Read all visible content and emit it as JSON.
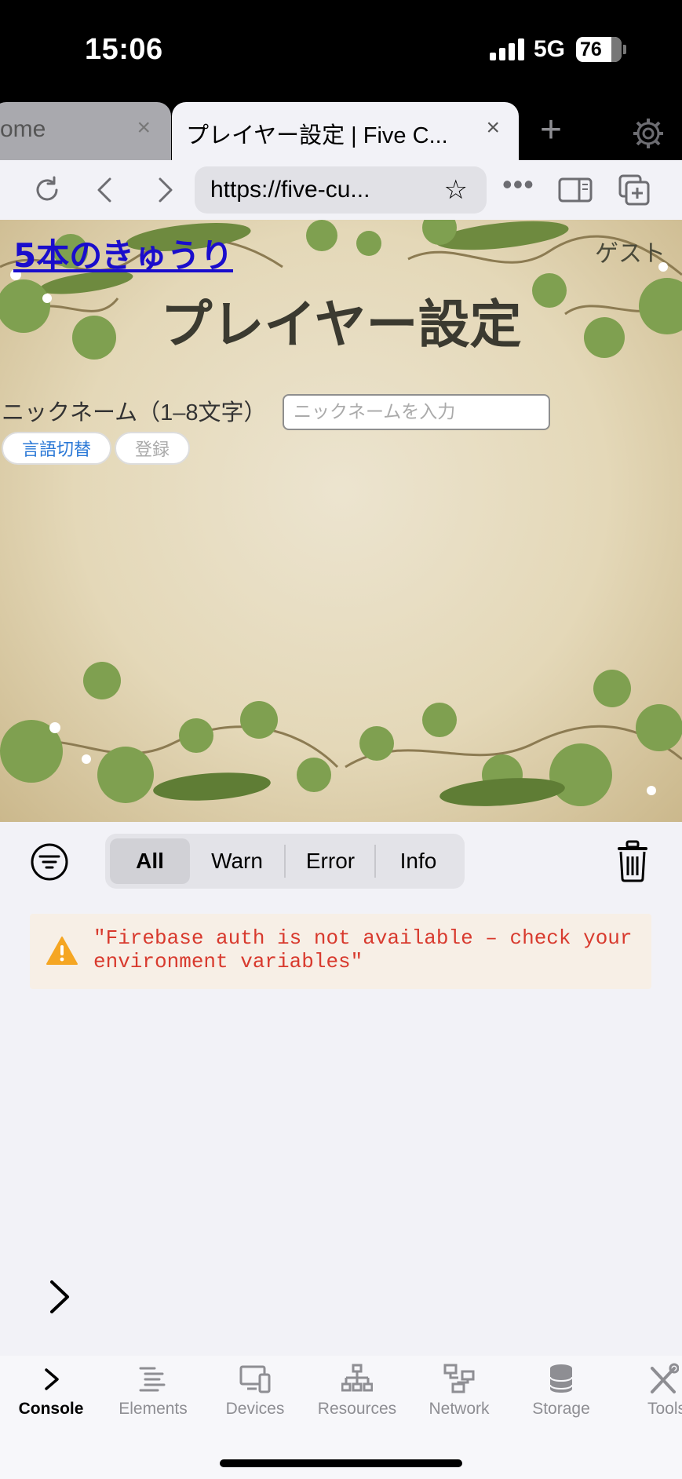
{
  "status_bar": {
    "time": "15:06",
    "network": "5G",
    "battery": "76"
  },
  "tabs": {
    "inactive_title": "ome",
    "active_title": "プレイヤー設定 | Five C...",
    "close_glyph": "×",
    "new_tab_glyph": "+"
  },
  "toolbar": {
    "url": "https://five-cu...",
    "star_glyph": "☆",
    "more_glyph": "•••"
  },
  "page": {
    "site_link": "5本のきゅうり",
    "guest_label": "ゲスト",
    "title": "プレイヤー設定",
    "nickname_label": "ニックネーム（1–8文字）",
    "nickname_placeholder": "ニックネームを入力",
    "nickname_value": "",
    "lang_button": "言語切替",
    "register_button": "登録"
  },
  "console": {
    "filters": [
      "All",
      "Warn",
      "Error",
      "Info"
    ],
    "selected_filter": "All",
    "log": {
      "level": "warning",
      "message": "\"Firebase auth is not available – check your environment variables\""
    }
  },
  "devtools_tabs": [
    {
      "label": "Console",
      "icon": "console-chevron-icon",
      "active": true
    },
    {
      "label": "Elements",
      "icon": "elements-list-icon",
      "active": false
    },
    {
      "label": "Devices",
      "icon": "devices-icon",
      "active": false
    },
    {
      "label": "Resources",
      "icon": "resources-tree-icon",
      "active": false
    },
    {
      "label": "Network",
      "icon": "network-icon",
      "active": false
    },
    {
      "label": "Storage",
      "icon": "storage-database-icon",
      "active": false
    },
    {
      "label": "Tools",
      "icon": "tools-wrench-icon",
      "active": false
    }
  ],
  "colors": {
    "link": "#1a0dcc",
    "warning_text": "#d83a2e",
    "warning_icon": "#f5a623",
    "lang_button_text": "#2a78d6"
  }
}
